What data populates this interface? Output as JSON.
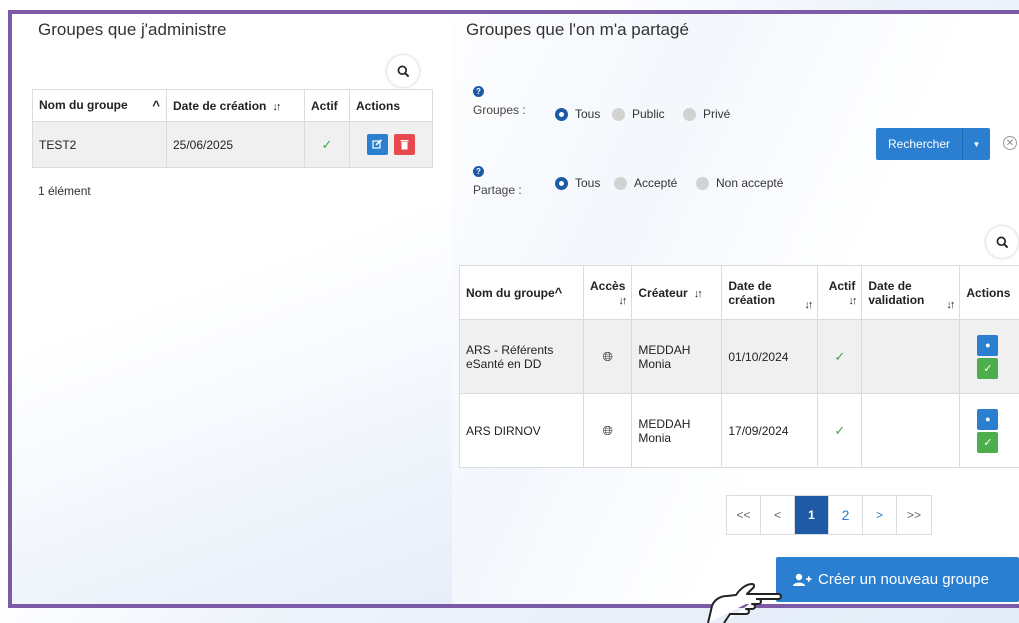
{
  "left": {
    "title": "Groupes que j'administre",
    "headers": {
      "name": "Nom du groupe",
      "date": "Date de création",
      "active": "Actif",
      "actions": "Actions"
    },
    "rows": [
      {
        "name": "TEST2",
        "date": "25/06/2025"
      }
    ],
    "count": "1 élément"
  },
  "right": {
    "title": "Groupes que l'on m'a partagé",
    "filters": {
      "groups_label": "Groupes :",
      "groups_options": [
        "Tous",
        "Public",
        "Privé"
      ],
      "share_label": "Partage :",
      "share_options": [
        "Tous",
        "Accepté",
        "Non accepté"
      ],
      "search_button": "Rechercher"
    },
    "headers": {
      "name": "Nom du groupe",
      "access": "Accès",
      "creator": "Créateur",
      "date_created": "Date de création",
      "active": "Actif",
      "date_validated": "Date de validation",
      "actions": "Actions"
    },
    "rows": [
      {
        "name": "ARS - Référents eSanté en DD",
        "creator": "MEDDAH Monia",
        "date": "01/10/2024"
      },
      {
        "name": "ARS DIRNOV",
        "creator": "MEDDAH Monia",
        "date": "17/09/2024"
      }
    ],
    "pager": [
      "<<",
      "<",
      "1",
      "2",
      ">",
      ">>"
    ],
    "create_button": "Créer un nouveau groupe"
  },
  "colors": {
    "accent": "#2a7fd1",
    "frame": "#7b5aa6",
    "danger": "#e8494e",
    "success": "#4cae4c"
  }
}
